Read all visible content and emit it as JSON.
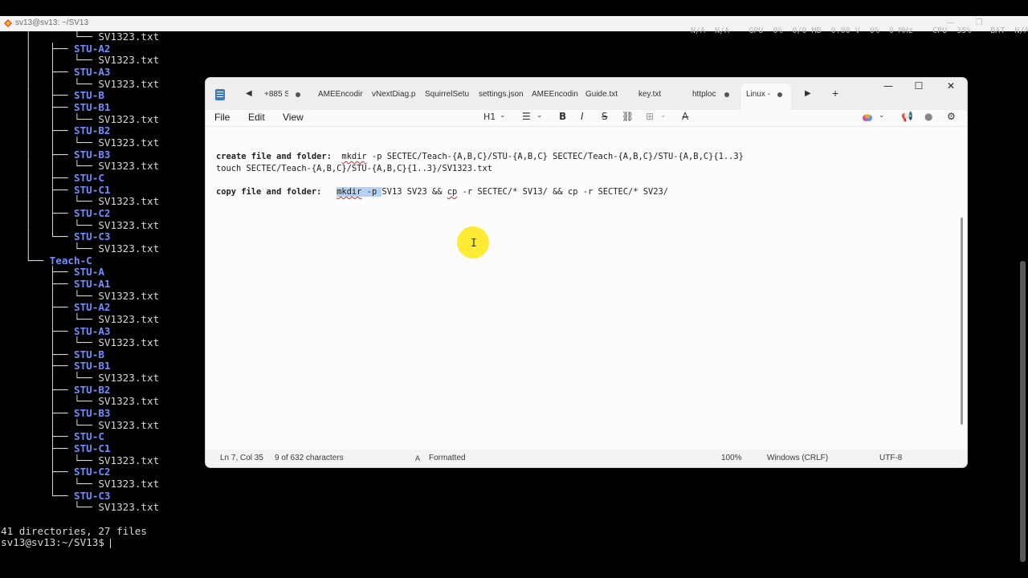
{
  "terminal": {
    "title": "sv13@sv13: ~/SV13",
    "window_controls": [
      "—",
      "❐"
    ],
    "status_strip": "N/A  N/A    GPU  0%  0/0 MB  0.00 V  0%  0 MHz    CPU  35%    BAT  N/A  N/A",
    "lines": [
      {
        "prefix": "    │       └── ",
        "text": "SV1323.txt",
        "kind": "file"
      },
      {
        "prefix": "    │   ├── ",
        "text": "STU-A2",
        "kind": "dir"
      },
      {
        "prefix": "    │   │   └── ",
        "text": "SV1323.txt",
        "kind": "file"
      },
      {
        "prefix": "    │   ├── ",
        "text": "STU-A3",
        "kind": "dir"
      },
      {
        "prefix": "    │   │   └── ",
        "text": "SV1323.txt",
        "kind": "file"
      },
      {
        "prefix": "    │   ├── ",
        "text": "STU-B",
        "kind": "dir"
      },
      {
        "prefix": "    │   ├── ",
        "text": "STU-B1",
        "kind": "dir"
      },
      {
        "prefix": "    │   │   └── ",
        "text": "SV1323.txt",
        "kind": "file"
      },
      {
        "prefix": "    │   ├── ",
        "text": "STU-B2",
        "kind": "dir"
      },
      {
        "prefix": "    │   │   └── ",
        "text": "SV1323.txt",
        "kind": "file"
      },
      {
        "prefix": "    │   ├── ",
        "text": "STU-B3",
        "kind": "dir"
      },
      {
        "prefix": "    │   │   └── ",
        "text": "SV1323.txt",
        "kind": "file"
      },
      {
        "prefix": "    │   ├── ",
        "text": "STU-C",
        "kind": "dir"
      },
      {
        "prefix": "    │   ├── ",
        "text": "STU-C1",
        "kind": "dir"
      },
      {
        "prefix": "    │   │   └── ",
        "text": "SV1323.txt",
        "kind": "file"
      },
      {
        "prefix": "    │   ├── ",
        "text": "STU-C2",
        "kind": "dir"
      },
      {
        "prefix": "    │   │   └── ",
        "text": "SV1323.txt",
        "kind": "file"
      },
      {
        "prefix": "    │   └── ",
        "text": "STU-C3",
        "kind": "dir"
      },
      {
        "prefix": "    │       └── ",
        "text": "SV1323.txt",
        "kind": "file"
      },
      {
        "prefix": "    └── ",
        "text": "Teach-C",
        "kind": "dir"
      },
      {
        "prefix": "        ├── ",
        "text": "STU-A",
        "kind": "dir"
      },
      {
        "prefix": "        ├── ",
        "text": "STU-A1",
        "kind": "dir"
      },
      {
        "prefix": "        │   └── ",
        "text": "SV1323.txt",
        "kind": "file"
      },
      {
        "prefix": "        ├── ",
        "text": "STU-A2",
        "kind": "dir"
      },
      {
        "prefix": "        │   └── ",
        "text": "SV1323.txt",
        "kind": "file"
      },
      {
        "prefix": "        ├── ",
        "text": "STU-A3",
        "kind": "dir"
      },
      {
        "prefix": "        │   └── ",
        "text": "SV1323.txt",
        "kind": "file"
      },
      {
        "prefix": "        ├── ",
        "text": "STU-B",
        "kind": "dir"
      },
      {
        "prefix": "        ├── ",
        "text": "STU-B1",
        "kind": "dir"
      },
      {
        "prefix": "        │   └── ",
        "text": "SV1323.txt",
        "kind": "file"
      },
      {
        "prefix": "        ├── ",
        "text": "STU-B2",
        "kind": "dir"
      },
      {
        "prefix": "        │   └── ",
        "text": "SV1323.txt",
        "kind": "file"
      },
      {
        "prefix": "        ├── ",
        "text": "STU-B3",
        "kind": "dir"
      },
      {
        "prefix": "        │   └── ",
        "text": "SV1323.txt",
        "kind": "file"
      },
      {
        "prefix": "        ├── ",
        "text": "STU-C",
        "kind": "dir"
      },
      {
        "prefix": "        ├── ",
        "text": "STU-C1",
        "kind": "dir"
      },
      {
        "prefix": "        │   └── ",
        "text": "SV1323.txt",
        "kind": "file"
      },
      {
        "prefix": "        ├── ",
        "text": "STU-C2",
        "kind": "dir"
      },
      {
        "prefix": "        │   └── ",
        "text": "SV1323.txt",
        "kind": "file"
      },
      {
        "prefix": "        └── ",
        "text": "STU-C3",
        "kind": "dir"
      },
      {
        "prefix": "            └── ",
        "text": "SV1323.txt",
        "kind": "file"
      },
      {
        "prefix": "",
        "text": "",
        "kind": "plain"
      },
      {
        "prefix": "",
        "text": "41 directories, 27 files",
        "kind": "plain"
      },
      {
        "prefix": "",
        "text": "sv13@sv13:~/SV13$ ",
        "kind": "prompt"
      }
    ]
  },
  "notepad": {
    "tabs": [
      {
        "label": "+885 S",
        "modified": true
      },
      {
        "label": "AMEEncodin",
        "modified": false
      },
      {
        "label": "vNextDiag.p",
        "modified": false
      },
      {
        "label": "SquirrelSetu",
        "modified": false
      },
      {
        "label": "settings.json",
        "modified": false
      },
      {
        "label": "AMEEncodin",
        "modified": false
      },
      {
        "label": "Guide.txt",
        "modified": false
      },
      {
        "label": "key.txt",
        "modified": false
      },
      {
        "label": "httploc",
        "modified": true
      },
      {
        "label": "Linux -",
        "modified": true,
        "active": true
      }
    ],
    "tab_nav": {
      "prev": "◀",
      "next": "▶",
      "add": "+"
    },
    "window_controls": {
      "minimize": "—",
      "maximize": "☐",
      "close": "✕"
    },
    "menu": {
      "file": "File",
      "edit": "Edit",
      "view": "View"
    },
    "toolbar": {
      "heading": "H1",
      "bold": "B",
      "italic": "I",
      "strike": "S",
      "list": "☰",
      "link": "⛓",
      "table": "⊞",
      "clear_format": "A̶"
    },
    "editor": {
      "line1_label": "create file and folder:",
      "line1_cmd": "mkdir",
      "line1_rest": " -p SECTEC/Teach-{A,B,C}/STU-{A,B,C} SECTEC/Teach-{A,B,C}/STU-{A,B,C}{1..3}",
      "line2": "touch SECTEC/Teach-{A,B,C}/STU-{A,B,C}{1..3}/SV1323.txt",
      "line3_label": "copy file and folder:",
      "line3_sel_cmd": "mkdir",
      "line3_sel_rest": " -p ",
      "line3_mid": "SV13 SV23 && ",
      "line3_cp": "cp",
      "line3_rest": " -r SECTEC/* SV13/ && cp -r SECTEC/* SV23/"
    },
    "status": {
      "position": "Ln 7, Col 35",
      "selection": "9 of 632 characters",
      "format_icon": "A",
      "format": "Formatted",
      "zoom": "100%",
      "line_endings": "Windows (CRLF)",
      "encoding": "UTF-8"
    }
  }
}
